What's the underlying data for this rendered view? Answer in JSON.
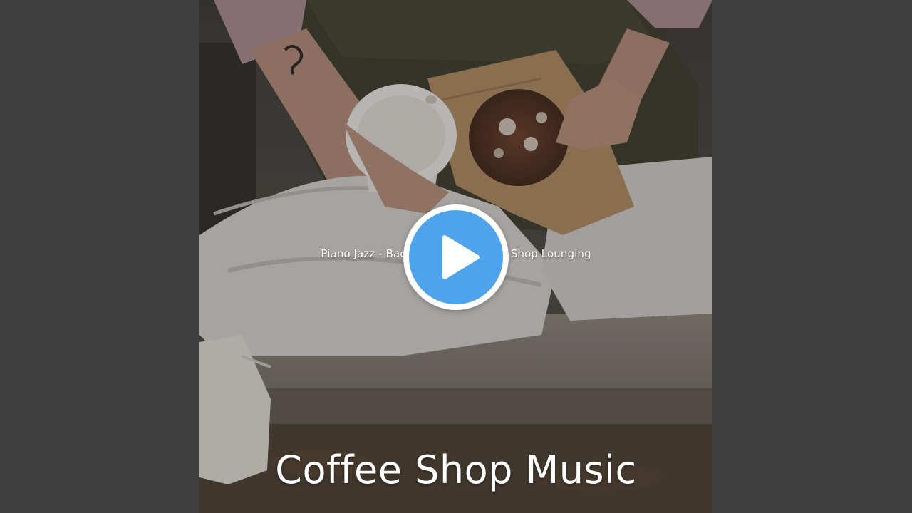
{
  "video": {
    "track_title": "Piano Jazz - Background for Coffee Shop Lounging",
    "album_title": "Coffee Shop Music"
  },
  "controls": {
    "play_icon": "play-icon",
    "accent_color": "#4fa3ea"
  },
  "theme": {
    "letterbox_color": "#3f3f3f"
  }
}
